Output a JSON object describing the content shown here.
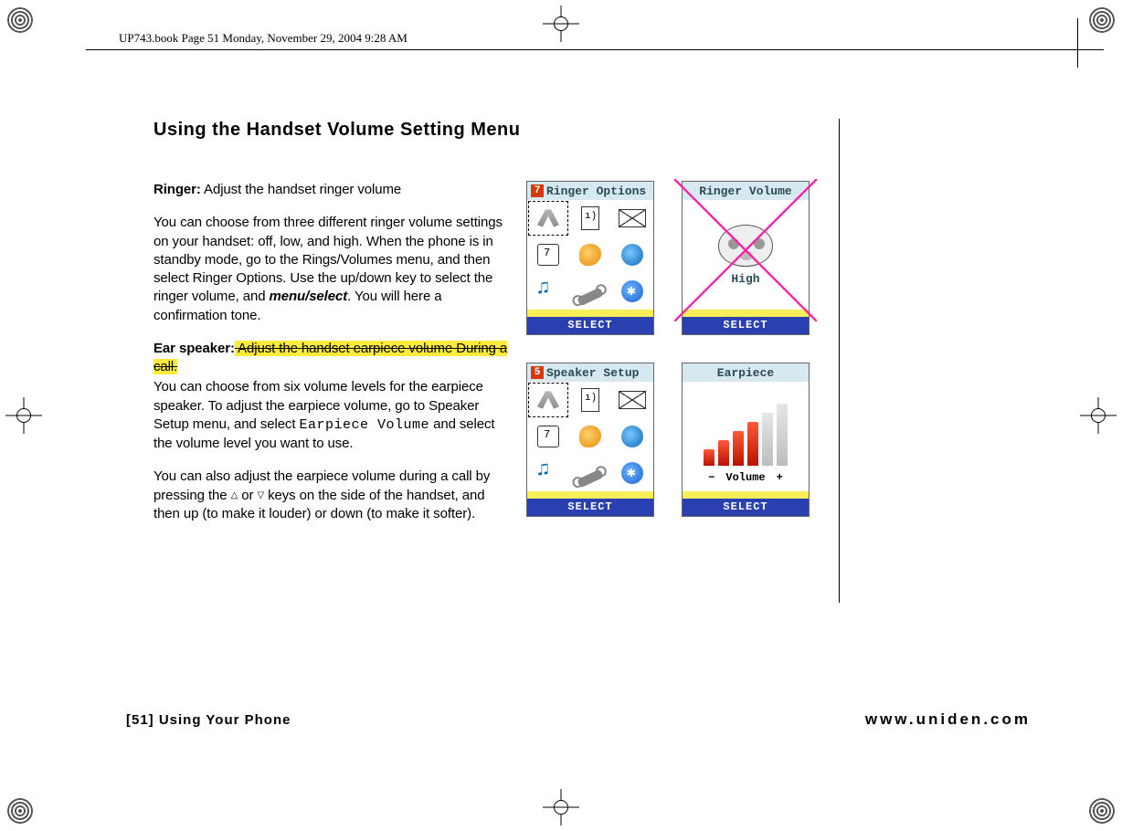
{
  "header_note": "UP743.book  Page 51  Monday, November 29, 2004  9:28 AM",
  "title": "Using the Handset Volume Setting Menu",
  "ringer": {
    "label": "Ringer:",
    "lead": " Adjust the handset ringer volume",
    "para": "You can choose from three different ringer volume settings on your handset: off, low, and high. When the phone is in standby mode, go to the Rings/Volumes menu, and then select Ringer Options. Use the up/down key to select the ringer volume, and ",
    "menukey": "menu/select",
    "para_tail": ". You will here a confirmation tone."
  },
  "ear": {
    "label": "Ear speaker:",
    "strike": " Adjust the handset earpiece volume During a call.",
    "para1a": "You can choose from six volume levels for the earpiece speaker. To adjust the earpiece volume, go to Speaker Setup menu, and select ",
    "earpiece_volume_label": "Earpiece Volume",
    "para1b": " and select the volume level you want to use.",
    "para2a": "You can also adjust the earpiece volume during a call by pressing the ",
    "up_tri": "△",
    "or": " or ",
    "down_tri": "▽",
    "para2b": " keys on the side of the handset, and then up (to make it louder) or down (to make it softer)."
  },
  "screens": {
    "select_label": "SELECT",
    "ringer_options": {
      "num": "7",
      "title": "Ringer Options"
    },
    "ringer_volume": {
      "title": "Ringer Volume",
      "level": "High"
    },
    "speaker_setup": {
      "num": "5",
      "title": "Speaker Setup"
    },
    "earpiece": {
      "title": "Earpiece",
      "minus": "−",
      "vol": "Volume",
      "plus": "+"
    }
  },
  "footer": {
    "left": "[51] Using Your Phone",
    "right": "www.uniden.com"
  }
}
